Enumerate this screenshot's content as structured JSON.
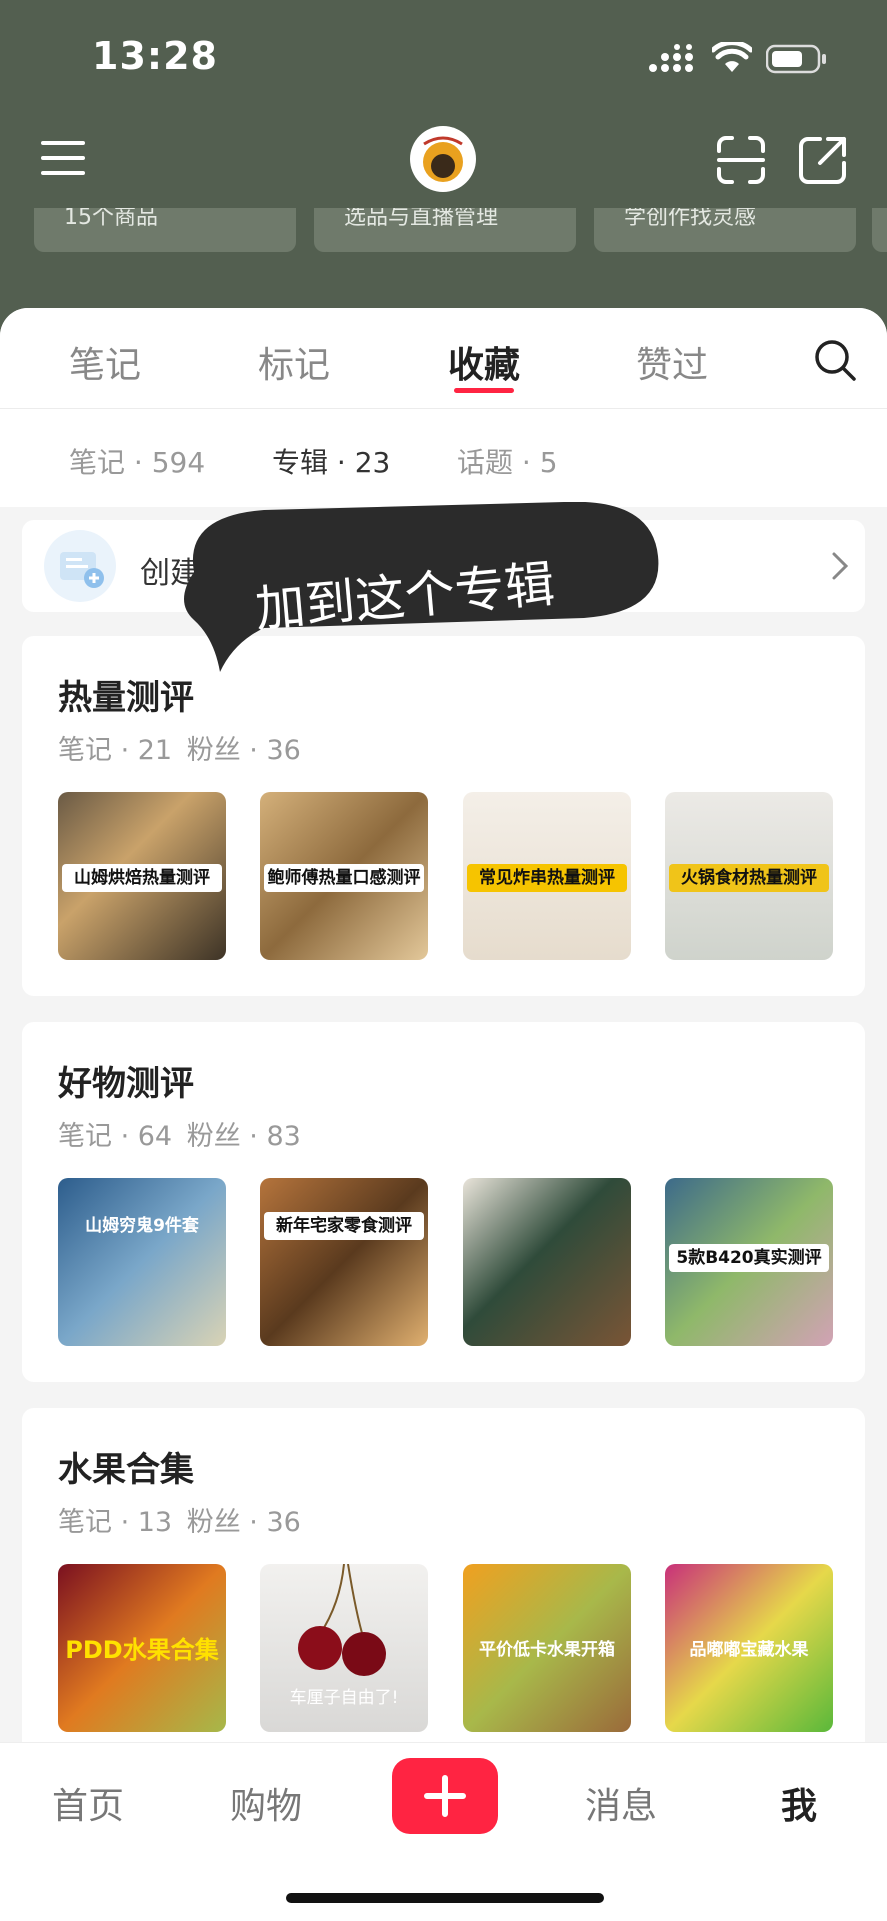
{
  "status": {
    "time": "13:28"
  },
  "header": {
    "quick_cards": [
      "15个商品",
      "选品与直播管理",
      "学创作找灵感"
    ]
  },
  "tabs": [
    {
      "label": "笔记"
    },
    {
      "label": "标记"
    },
    {
      "label": "收藏",
      "active": true
    },
    {
      "label": "赞过"
    }
  ],
  "subtabs": [
    {
      "label": "笔记 · 594"
    },
    {
      "label": "专辑 · 23",
      "active": true
    },
    {
      "label": "话题 · 5"
    }
  ],
  "create_album": {
    "label": "创建新专辑"
  },
  "tooltip": {
    "text": "加到这个专辑"
  },
  "albums": [
    {
      "title": "热量测评",
      "notes": "笔记 · 21",
      "fans": "粉丝 · 36",
      "thumbs": [
        {
          "caption": "山姆烘焙热量测评"
        },
        {
          "caption": "鲍师傅热量口感测评"
        },
        {
          "caption": "常见炸串热量测评"
        },
        {
          "caption": "火锅食材热量测评"
        }
      ]
    },
    {
      "title": "好物测评",
      "notes": "笔记 · 64",
      "fans": "粉丝 · 83",
      "thumbs": [
        {
          "caption": "山姆穷鬼9件套"
        },
        {
          "caption": "新年宅家零食测评"
        },
        {
          "caption": ""
        },
        {
          "caption": "5款B420真实测评"
        }
      ]
    },
    {
      "title": "水果合集",
      "notes": "笔记 · 13",
      "fans": "粉丝 · 36",
      "thumbs": [
        {
          "caption": "PDD水果合集"
        },
        {
          "caption": "车厘子自由了!"
        },
        {
          "caption": "平价低卡水果开箱"
        },
        {
          "caption": "品嘟嘟宝藏水果"
        }
      ]
    }
  ],
  "bottom_nav": [
    {
      "label": "首页"
    },
    {
      "label": "购物"
    },
    {
      "label": "消息"
    },
    {
      "label": "我",
      "active": true
    }
  ],
  "colors": {
    "accent": "#ff2442",
    "header_bg": "#535f50"
  }
}
